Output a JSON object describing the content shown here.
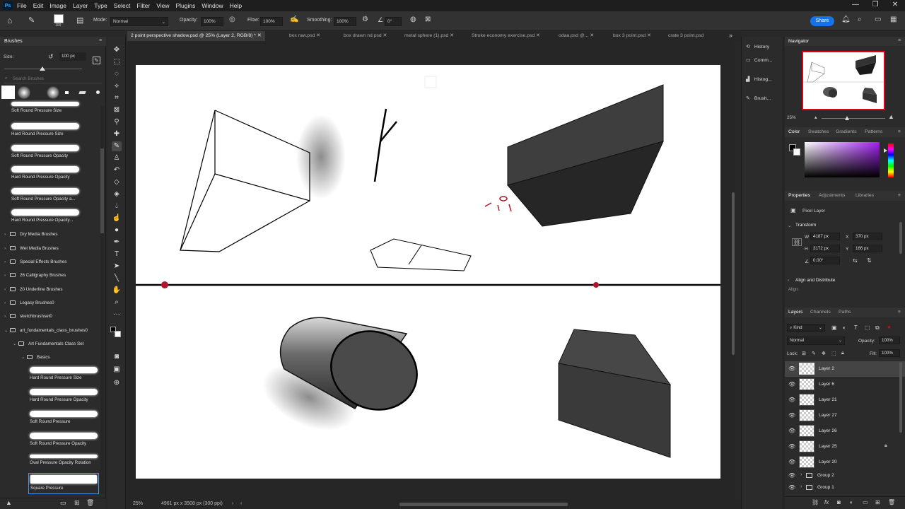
{
  "menubar": {
    "logo": "Ps",
    "items": [
      "File",
      "Edit",
      "Image",
      "Layer",
      "Type",
      "Select",
      "Filter",
      "View",
      "Plugins",
      "Window",
      "Help"
    ]
  },
  "window_controls": {
    "minimize": "—",
    "restore": "❐",
    "close": "✕"
  },
  "options_bar": {
    "brush_size": "100",
    "mode_label": "Mode:",
    "mode_value": "Normal",
    "opacity_label": "Opacity:",
    "opacity_value": "100%",
    "flow_label": "Flow:",
    "flow_value": "100%",
    "smoothing_label": "Smoothing:",
    "smoothing_value": "100%",
    "angle_value": "0°",
    "share_label": "Share"
  },
  "brushes_panel": {
    "title": "Brushes",
    "size_label": "Size:",
    "size_value": "100 px",
    "search_placeholder": "Search Brushes",
    "top_presets": [
      "Soft Round Pressure Size",
      "Hard Round Pressure Size",
      "Soft Round Pressure Opacity",
      "Hard Round Pressure Opacity",
      "Soft Round Pressure Opacity a...",
      "Hard Round Pressure Opacity..."
    ],
    "folders": [
      "Dry Media Brushes",
      "Wet Media Brushes",
      "Special Effects Brushes",
      "26 Calligraphy Brushes",
      "20 Underline Brushes",
      "Legacy Brushes0",
      "sketchbrushset0",
      "art_fundamentals_class_brushes0"
    ],
    "subfolder": "Art Fundamentals Class Set",
    "subsubfolder": "Basics",
    "class_presets": [
      "Hard Round Pressure Size",
      "Hard Round Pressure Opacity",
      "Soft Round Pressure",
      "Soft Round Pressure Opacity",
      "Oval Pressure Opacity Rotation",
      "Square Pressure"
    ]
  },
  "tabs": [
    {
      "label": "2 point perspective shadow.psd @ 25% (Layer 2, RGB/8) *",
      "active": true
    },
    {
      "label": "box raw.psd",
      "active": false
    },
    {
      "label": "box drawn nd.psd",
      "active": false
    },
    {
      "label": "metal sphere (1).psd",
      "active": false
    },
    {
      "label": "Stroke economy exercise.psd",
      "active": false
    },
    {
      "label": "odaa.psd @...",
      "active": false
    },
    {
      "label": "box 3 point.psd",
      "active": false
    },
    {
      "label": "crate 3 point.psd",
      "active": false
    }
  ],
  "status_bar": {
    "zoom": "25%",
    "doc_info": "4961 px x 3508 px (300 ppi)"
  },
  "icon_strip": [
    "History",
    "Comm...",
    "Histog...",
    "Brush..."
  ],
  "navigator": {
    "title": "Navigator",
    "zoom": "25%"
  },
  "color_panel": {
    "tabs": [
      "Color",
      "Swatches",
      "Gradients",
      "Patterns"
    ],
    "active": "Color"
  },
  "properties_panel": {
    "tabs": [
      "Properties",
      "Adjustments",
      "Libraries"
    ],
    "active": "Properties",
    "layer_type": "Pixel Layer",
    "transform_title": "Transform",
    "w_label": "W",
    "w_value": "4187 px",
    "h_label": "H",
    "h_value": "3172 px",
    "x_label": "X",
    "x_value": "370 px",
    "y_label": "Y",
    "y_value": "166 px",
    "angle_value": "0.00°",
    "align_title": "Align and Distribute",
    "align_label": "Align:"
  },
  "layers_panel": {
    "tabs": [
      "Layers",
      "Channels",
      "Paths"
    ],
    "active": "Layers",
    "kind": "Kind",
    "blend_mode": "Normal",
    "opacity_label": "Opacity:",
    "opacity_value": "100%",
    "lock_label": "Lock:",
    "fill_label": "Fill:",
    "fill_value": "100%",
    "layers": [
      "Layer 2",
      "Layer 6",
      "Layer 21",
      "Layer 27",
      "Layer 26",
      "Layer 25",
      "Layer 20",
      "Group 2",
      "Group 1"
    ]
  },
  "colors": {
    "accent": "#1473e6",
    "bg": "#282828",
    "panel": "#2b2b2b",
    "canvas": "#ffffff",
    "point_red": "#b0162b"
  }
}
